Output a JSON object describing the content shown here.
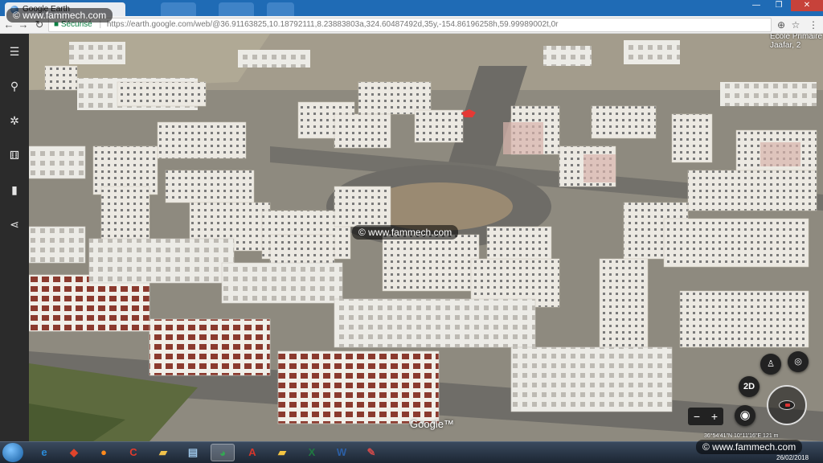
{
  "browser": {
    "tab_title": "Google Earth",
    "secure_label": "Sécurisé",
    "url": "https://earth.google.com/web/@36.91163825,10.18792111,8.23883803a,324.60487492d,35y,-154.86196258h,59.99989002t,0r",
    "window_buttons": {
      "minimize": "—",
      "maximize": "❐",
      "close": "✕"
    },
    "nav": {
      "back": "←",
      "forward": "→",
      "reload": "↻"
    },
    "omni_icons": {
      "location": "⊕",
      "star": "☆",
      "menu": "⋮"
    }
  },
  "sidebar": {
    "items": [
      {
        "name": "menu-icon",
        "glyph": "☰"
      },
      {
        "name": "search-icon",
        "glyph": "⚲"
      },
      {
        "name": "voyager-icon",
        "glyph": "✲"
      },
      {
        "name": "feeling-lucky-icon",
        "glyph": "⚅"
      },
      {
        "name": "projects-icon",
        "glyph": "▮"
      },
      {
        "name": "share-icon",
        "glyph": "⋖"
      }
    ]
  },
  "map": {
    "place_label_line1": "Ecole Primaire",
    "place_label_line2": "Jaafar, 2",
    "google_logo": "Google™",
    "footer_text": "36°54'41\"N 10°11'16\"E  121 m",
    "controls": {
      "pegman": "♙",
      "my_location": "◎",
      "view_2d": "2D",
      "zoom_out": "−",
      "zoom_in": "+",
      "globe": "◉"
    },
    "colors": {
      "pin": "#e53935",
      "ground": "#8d8a80",
      "building": "#e9e6df",
      "roof": "#8b3a2e"
    }
  },
  "watermarks": {
    "top": "© www.fammech.com",
    "center": "© www.fammech.com",
    "bottom": "© www.fammech.com"
  },
  "taskbar": {
    "apps": [
      {
        "name": "ie-taskbar",
        "glyph": "e",
        "color": "#2a8ad8"
      },
      {
        "name": "media-taskbar",
        "glyph": "◆",
        "color": "#e0442b"
      },
      {
        "name": "firefox-taskbar",
        "glyph": "●",
        "color": "#ff8a1c"
      },
      {
        "name": "ccleaner-taskbar",
        "glyph": "C",
        "color": "#e33a2c"
      },
      {
        "name": "explorer-taskbar",
        "glyph": "▰",
        "color": "#f0c14b"
      },
      {
        "name": "scanner-taskbar",
        "glyph": "▤",
        "color": "#9cc4e6"
      },
      {
        "name": "chrome-taskbar",
        "glyph": "◕",
        "color": "#34a853",
        "active": true
      },
      {
        "name": "acrobat-taskbar",
        "glyph": "A",
        "color": "#d6362b"
      },
      {
        "name": "folder-taskbar",
        "glyph": "▰",
        "color": "#f4c542"
      },
      {
        "name": "excel-taskbar",
        "glyph": "X",
        "color": "#1f7a40"
      },
      {
        "name": "word-taskbar",
        "glyph": "W",
        "color": "#2b5fa6"
      },
      {
        "name": "paint-taskbar",
        "glyph": "✎",
        "color": "#d04a4a"
      }
    ],
    "date": "26/02/2018"
  }
}
